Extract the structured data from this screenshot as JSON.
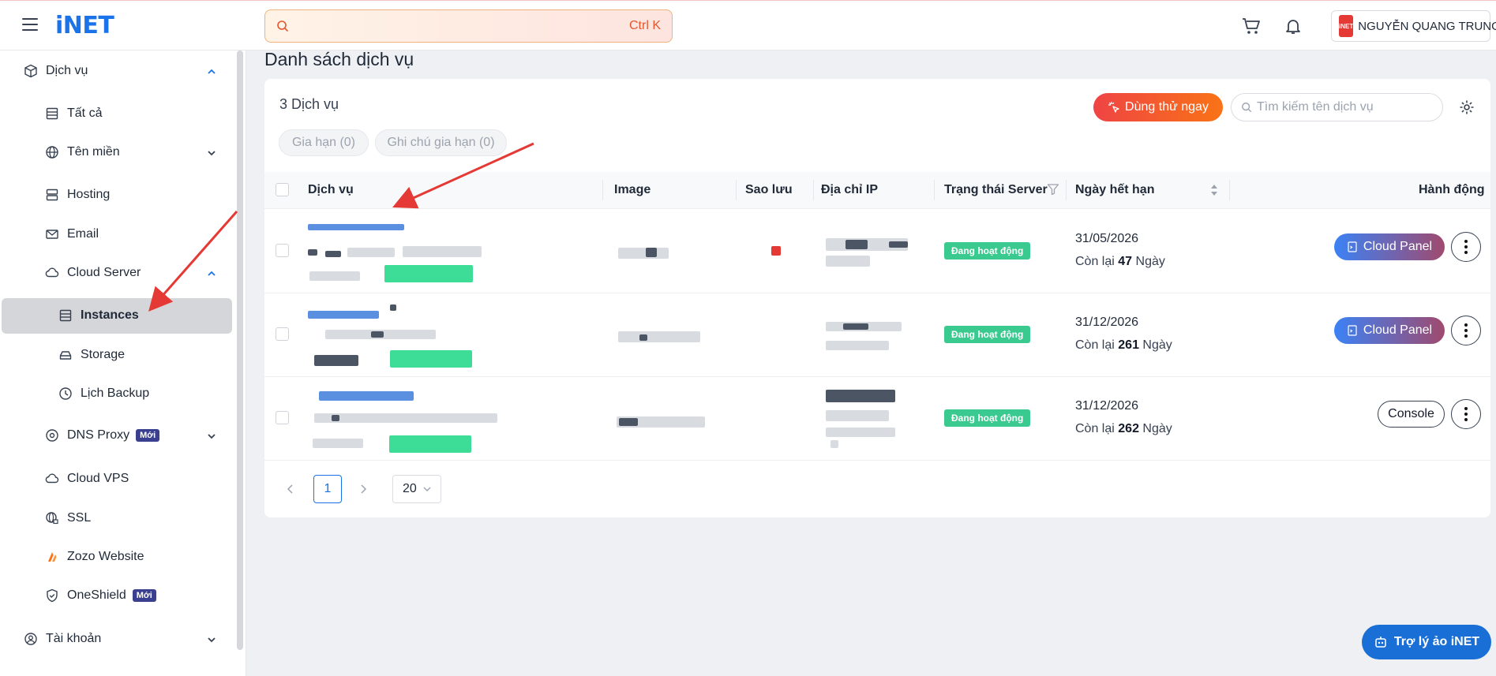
{
  "header": {
    "logo": "iNET",
    "search_shortcut": "Ctrl K",
    "user_badge": "iNET",
    "user_name": "NGUYỄN QUANG TRUNG"
  },
  "sidebar": {
    "items": [
      {
        "label": "Dịch vụ",
        "icon": "box-icon"
      },
      {
        "label": "Tất cả",
        "icon": "list-icon"
      },
      {
        "label": "Tên miền",
        "icon": "globe-icon"
      },
      {
        "label": "Hosting",
        "icon": "server-icon"
      },
      {
        "label": "Email",
        "icon": "mail-icon"
      },
      {
        "label": "Cloud Server",
        "icon": "cloud-icon"
      },
      {
        "label": "Instances",
        "icon": "list-icon"
      },
      {
        "label": "Storage",
        "icon": "drive-icon"
      },
      {
        "label": "Lịch Backup",
        "icon": "clock-icon"
      },
      {
        "label": "DNS Proxy",
        "icon": "dns-icon",
        "badge": "Mới"
      },
      {
        "label": "Cloud VPS",
        "icon": "cloud-icon"
      },
      {
        "label": "SSL",
        "icon": "globe-lock-icon"
      },
      {
        "label": "Zozo Website",
        "icon": "zozo-icon"
      },
      {
        "label": "OneShield",
        "icon": "shield-icon",
        "badge": "Mới"
      },
      {
        "label": "Tài khoản",
        "icon": "user-icon"
      }
    ]
  },
  "main": {
    "page_title": "Danh sách dịch vụ",
    "service_count": "3 Dịch vụ",
    "filters": [
      "Gia hạn (0)",
      "Ghi chú gia hạn (0)"
    ],
    "try_button": "Dùng thử ngay",
    "search_placeholder": "Tìm kiếm tên dịch vụ",
    "columns": [
      "Dịch vụ",
      "Image",
      "Sao lưu",
      "Địa chỉ IP",
      "Trạng thái Server",
      "Ngày hết hạn",
      "Hành động"
    ],
    "rows": [
      {
        "status": "Đang hoạt động",
        "expiry": "31/05/2026",
        "remain_prefix": "Còn lại",
        "remain_days": "47",
        "remain_suffix": "Ngày",
        "action": "Cloud Panel"
      },
      {
        "status": "Đang hoạt động",
        "expiry": "31/12/2026",
        "remain_prefix": "Còn lại",
        "remain_days": "261",
        "remain_suffix": "Ngày",
        "action": "Cloud Panel"
      },
      {
        "status": "Đang hoạt động",
        "expiry": "31/12/2026",
        "remain_prefix": "Còn lại",
        "remain_days": "262",
        "remain_suffix": "Ngày",
        "action": "Console"
      }
    ],
    "pagination": {
      "current_page": "1",
      "page_size": "20"
    }
  },
  "assistant_label": "Trợ lý ảo iNET",
  "colors": {
    "brand": "#1a73e8",
    "status_active": "#3ac98f",
    "annotation_arrow": "#e53935"
  }
}
